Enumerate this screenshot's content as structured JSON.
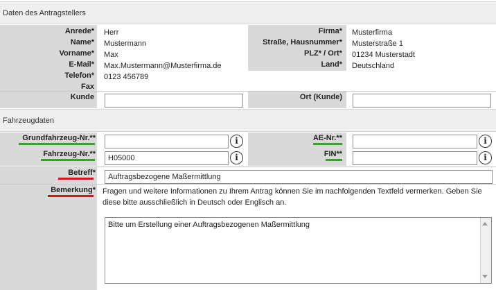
{
  "applicant": {
    "section_title": "Daten des Antragstellers",
    "left_labels": [
      "Anrede*",
      "Name*",
      "Vorname*",
      "E-Mail*",
      "Telefon*",
      "Fax"
    ],
    "left_values": [
      "Herr",
      "Mustermann",
      "Max",
      "Max.Mustermann@Musterfirma.de",
      "0123 456789",
      ""
    ],
    "right_labels": [
      "Firma*",
      "Straße, Hausnummer*",
      "PLZ* / Ort*",
      "Land*"
    ],
    "right_values": [
      "Musterfirma",
      "Musterstraße 1",
      "01234 Musterstadt",
      "Deutschland"
    ],
    "kunde_label": "Kunde",
    "kunde_value": "",
    "ort_kunde_label": "Ort (Kunde)",
    "ort_kunde_value": ""
  },
  "vehicle": {
    "section_title": "Fahrzeugdaten",
    "grundfahrzeug_label": "Grundfahrzeug-Nr.**",
    "grundfahrzeug_value": "",
    "ae_label": "AE-Nr.**",
    "ae_value": "",
    "fahrzeug_label": "Fahrzeug-Nr.**",
    "fahrzeug_value": "H05000",
    "fin_label": "FIN**",
    "fin_value": "",
    "betreff_label": "Betreff*",
    "betreff_value": "Auftragsbezogene Maßermittlung",
    "bemerkung_label": "Bemerkung*",
    "bemerkung_hint": "Fragen und weitere Informationen zu Ihrem Antrag können Sie im nachfolgenden Textfeld vermerken. Geben Sie diese bitte ausschließlich in Deutsch oder Englisch an.",
    "bemerkung_value": "Bitte um Erstellung einer Auftragsbezogenen Maßermittlung"
  },
  "icons": {
    "info": "i"
  },
  "colors": {
    "required_green": "#2faa1e",
    "required_red": "#d0161b",
    "label_bg": "#d9d9d9"
  }
}
